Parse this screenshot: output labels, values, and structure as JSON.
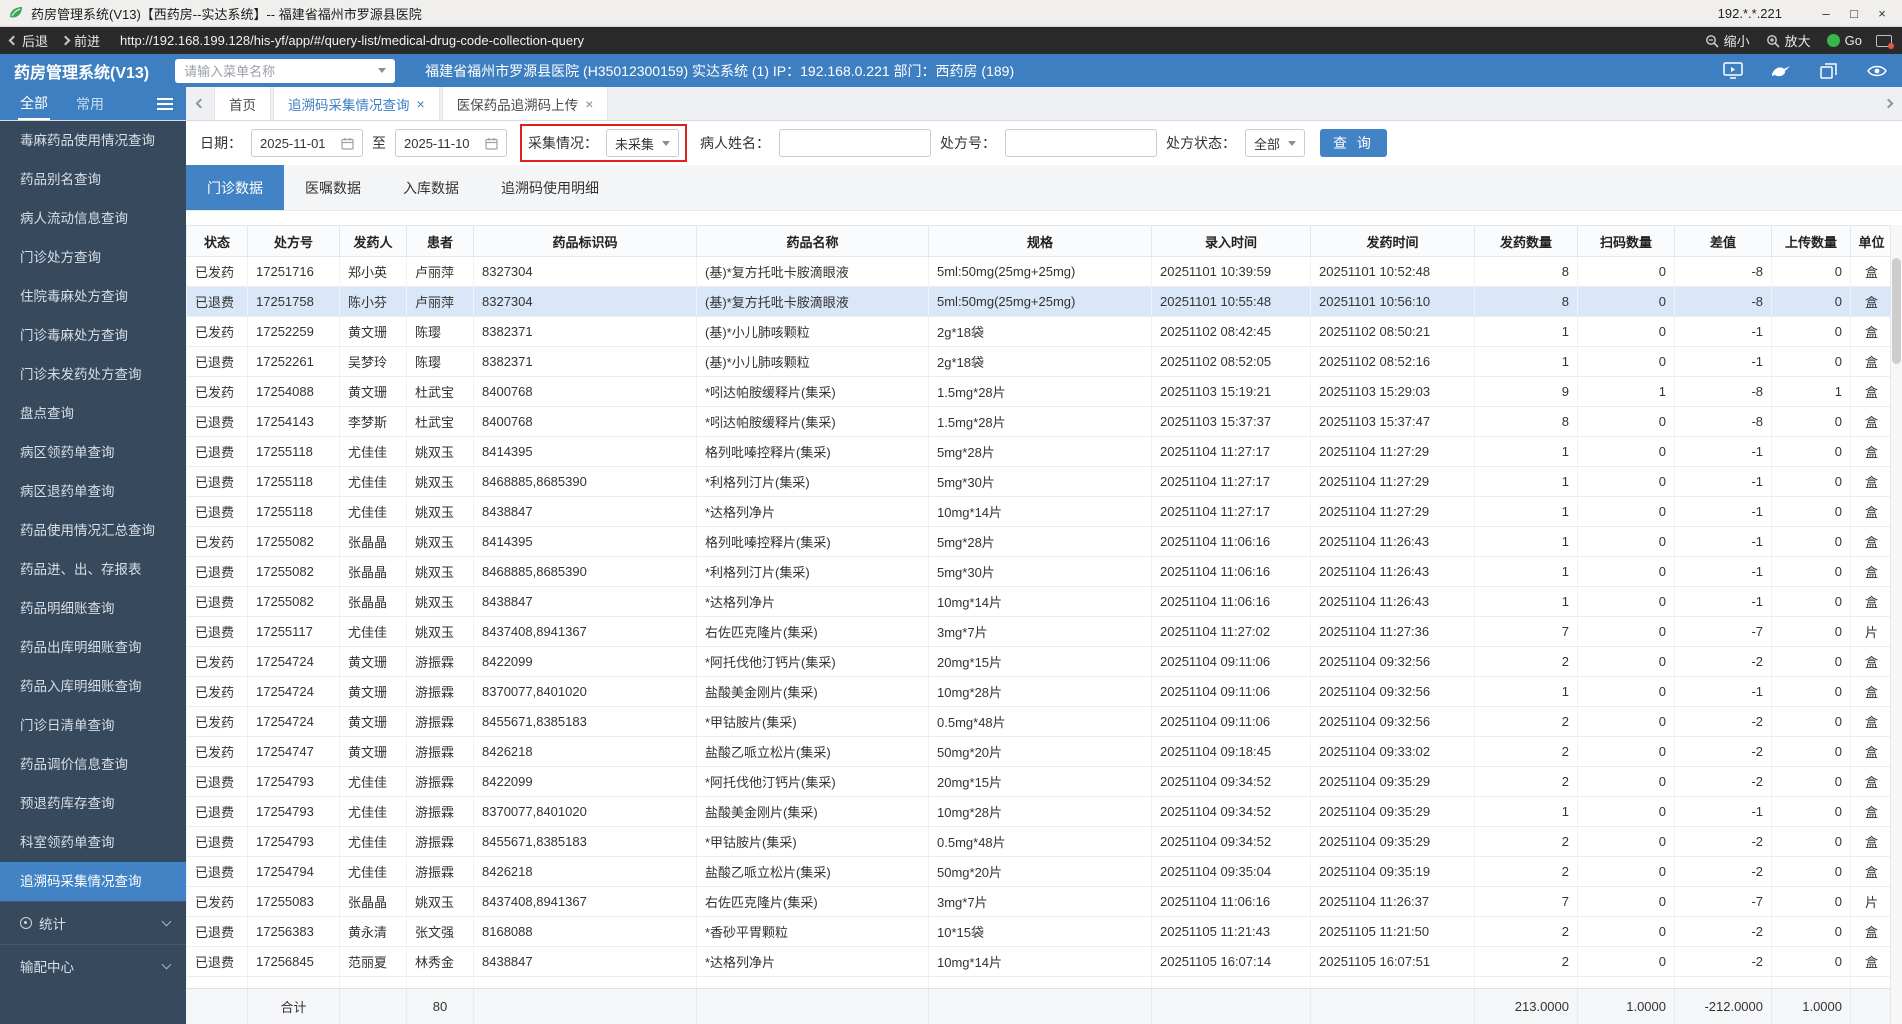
{
  "colors": {
    "accent_blue": "#4183c4",
    "header_blue": "#3e7fc1",
    "sidebar_bg": "#37495c",
    "highlight_row": "#d9e7f8",
    "alert_red": "#e0201c",
    "go_green": "#39b54a"
  },
  "titlebar": {
    "title": "药房管理系统(V13)【西药房--实达系统】-- 福建省福州市罗源县医院",
    "ip": "192.*.*.221",
    "window_controls": {
      "minimize": "–",
      "maximize": "□",
      "close": "×"
    }
  },
  "browser": {
    "back_label": "后退",
    "forward_label": "前进",
    "url": "http://192.168.199.128/his-yf/app/#/query-list/medical-drug-code-collection-query",
    "zoom_out_label": "缩小",
    "zoom_in_label": "放大",
    "go_label": "Go"
  },
  "header": {
    "app_name": "药房管理系统(V13)",
    "menu_search_placeholder": "请输入菜单名称",
    "hospital_info": "福建省福州市罗源县医院 (H35012300159) 实达系统 (1) IP：192.168.0.221 部门：西药房 (189)"
  },
  "tabstrip": {
    "all_label": "全部",
    "common_label": "常用",
    "tabs": [
      {
        "label": "首页",
        "closable": false,
        "active": false
      },
      {
        "label": "追溯码采集情况查询",
        "closable": true,
        "active": true
      },
      {
        "label": "医保药品追溯码上传",
        "closable": true,
        "active": false
      }
    ]
  },
  "sidebar": {
    "items": [
      "毒麻药品使用情况查询",
      "药品别名查询",
      "病人流动信息查询",
      "门诊处方查询",
      "住院毒麻处方查询",
      "门诊毒麻处方查询",
      "门诊未发药处方查询",
      "盘点查询",
      "病区领药单查询",
      "病区退药单查询",
      "药品使用情况汇总查询",
      "药品进、出、存报表",
      "药品明细账查询",
      "药品出库明细账查询",
      "药品入库明细账查询",
      "门诊日清单查询",
      "药品调价信息查询",
      "预退药库存查询",
      "科室领药单查询",
      "追溯码采集情况查询"
    ],
    "active_index": 19,
    "group_stats": "统计",
    "group_dispatch": "输配中心"
  },
  "filters": {
    "date_label": "日期：",
    "date_from": "2025-11-01",
    "to_label": "至",
    "date_to": "2025-11-10",
    "collect_label": "采集情况：",
    "collect_value": "未采集",
    "patient_label": "病人姓名：",
    "patient_value": "",
    "rx_label": "处方号：",
    "rx_value": "",
    "rx_status_label": "处方状态：",
    "rx_status_value": "全部",
    "query_button": "查 询"
  },
  "data_tabs": [
    "门诊数据",
    "医嘱数据",
    "入库数据",
    "追溯码使用明细"
  ],
  "data_tabs_active_index": 0,
  "table": {
    "columns": [
      "状态",
      "处方号",
      "发药人",
      "患者",
      "药品标识码",
      "药品名称",
      "规格",
      "录入时间",
      "发药时间",
      "发药数量",
      "扫码数量",
      "差值",
      "上传数量",
      "单位"
    ],
    "highlight_row_index": 1,
    "rows": [
      [
        "已发药",
        "17251716",
        "郑小英",
        "卢丽萍",
        "8327304",
        "(基)*复方托吡卡胺滴眼液",
        "5ml:50mg(25mg+25mg)",
        "20251101 10:39:59",
        "20251101 10:52:48",
        "8",
        "0",
        "-8",
        "0",
        "盒"
      ],
      [
        "已退费",
        "17251758",
        "陈小芬",
        "卢丽萍",
        "8327304",
        "(基)*复方托吡卡胺滴眼液",
        "5ml:50mg(25mg+25mg)",
        "20251101 10:55:48",
        "20251101 10:56:10",
        "8",
        "0",
        "-8",
        "0",
        "盒"
      ],
      [
        "已发药",
        "17252259",
        "黄文珊",
        "陈璎",
        "8382371",
        "(基)*小儿肺咳颗粒",
        "2g*18袋",
        "20251102 08:42:45",
        "20251102 08:50:21",
        "1",
        "0",
        "-1",
        "0",
        "盒"
      ],
      [
        "已退费",
        "17252261",
        "吴梦玲",
        "陈璎",
        "8382371",
        "(基)*小儿肺咳颗粒",
        "2g*18袋",
        "20251102 08:52:05",
        "20251102 08:52:16",
        "1",
        "0",
        "-1",
        "0",
        "盒"
      ],
      [
        "已发药",
        "17254088",
        "黄文珊",
        "杜武宝",
        "8400768",
        "*吲达帕胺缓释片(集采)",
        "1.5mg*28片",
        "20251103 15:19:21",
        "20251103 15:29:03",
        "9",
        "1",
        "-8",
        "1",
        "盒"
      ],
      [
        "已退费",
        "17254143",
        "李梦斯",
        "杜武宝",
        "8400768",
        "*吲达帕胺缓释片(集采)",
        "1.5mg*28片",
        "20251103 15:37:37",
        "20251103 15:37:47",
        "8",
        "0",
        "-8",
        "0",
        "盒"
      ],
      [
        "已退费",
        "17255118",
        "尤佳佳",
        "姚双玉",
        "8414395",
        "格列吡嗪控释片(集采)",
        "5mg*28片",
        "20251104 11:27:17",
        "20251104 11:27:29",
        "1",
        "0",
        "-1",
        "0",
        "盒"
      ],
      [
        "已退费",
        "17255118",
        "尤佳佳",
        "姚双玉",
        "8468885,8685390",
        "*利格列汀片(集采)",
        "5mg*30片",
        "20251104 11:27:17",
        "20251104 11:27:29",
        "1",
        "0",
        "-1",
        "0",
        "盒"
      ],
      [
        "已退费",
        "17255118",
        "尤佳佳",
        "姚双玉",
        "8438847",
        "*达格列净片",
        "10mg*14片",
        "20251104 11:27:17",
        "20251104 11:27:29",
        "1",
        "0",
        "-1",
        "0",
        "盒"
      ],
      [
        "已发药",
        "17255082",
        "张晶晶",
        "姚双玉",
        "8414395",
        "格列吡嗪控释片(集采)",
        "5mg*28片",
        "20251104 11:06:16",
        "20251104 11:26:43",
        "1",
        "0",
        "-1",
        "0",
        "盒"
      ],
      [
        "已退费",
        "17255082",
        "张晶晶",
        "姚双玉",
        "8468885,8685390",
        "*利格列汀片(集采)",
        "5mg*30片",
        "20251104 11:06:16",
        "20251104 11:26:43",
        "1",
        "0",
        "-1",
        "0",
        "盒"
      ],
      [
        "已退费",
        "17255082",
        "张晶晶",
        "姚双玉",
        "8438847",
        "*达格列净片",
        "10mg*14片",
        "20251104 11:06:16",
        "20251104 11:26:43",
        "1",
        "0",
        "-1",
        "0",
        "盒"
      ],
      [
        "已退费",
        "17255117",
        "尤佳佳",
        "姚双玉",
        "8437408,8941367",
        "右佐匹克隆片(集采)",
        "3mg*7片",
        "20251104 11:27:02",
        "20251104 11:27:36",
        "7",
        "0",
        "-7",
        "0",
        "片"
      ],
      [
        "已发药",
        "17254724",
        "黄文珊",
        "游振霖",
        "8422099",
        "*阿托伐他汀钙片(集采)",
        "20mg*15片",
        "20251104 09:11:06",
        "20251104 09:32:56",
        "2",
        "0",
        "-2",
        "0",
        "盒"
      ],
      [
        "已发药",
        "17254724",
        "黄文珊",
        "游振霖",
        "8370077,8401020",
        "盐酸美金刚片(集采)",
        "10mg*28片",
        "20251104 09:11:06",
        "20251104 09:32:56",
        "1",
        "0",
        "-1",
        "0",
        "盒"
      ],
      [
        "已发药",
        "17254724",
        "黄文珊",
        "游振霖",
        "8455671,8385183",
        "*甲钴胺片(集采)",
        "0.5mg*48片",
        "20251104 09:11:06",
        "20251104 09:32:56",
        "2",
        "0",
        "-2",
        "0",
        "盒"
      ],
      [
        "已发药",
        "17254747",
        "黄文珊",
        "游振霖",
        "8426218",
        "盐酸乙哌立松片(集采)",
        "50mg*20片",
        "20251104 09:18:45",
        "20251104 09:33:02",
        "2",
        "0",
        "-2",
        "0",
        "盒"
      ],
      [
        "已退费",
        "17254793",
        "尤佳佳",
        "游振霖",
        "8422099",
        "*阿托伐他汀钙片(集采)",
        "20mg*15片",
        "20251104 09:34:52",
        "20251104 09:35:29",
        "2",
        "0",
        "-2",
        "0",
        "盒"
      ],
      [
        "已退费",
        "17254793",
        "尤佳佳",
        "游振霖",
        "8370077,8401020",
        "盐酸美金刚片(集采)",
        "10mg*28片",
        "20251104 09:34:52",
        "20251104 09:35:29",
        "1",
        "0",
        "-1",
        "0",
        "盒"
      ],
      [
        "已退费",
        "17254793",
        "尤佳佳",
        "游振霖",
        "8455671,8385183",
        "*甲钴胺片(集采)",
        "0.5mg*48片",
        "20251104 09:34:52",
        "20251104 09:35:29",
        "2",
        "0",
        "-2",
        "0",
        "盒"
      ],
      [
        "已退费",
        "17254794",
        "尤佳佳",
        "游振霖",
        "8426218",
        "盐酸乙哌立松片(集采)",
        "50mg*20片",
        "20251104 09:35:04",
        "20251104 09:35:19",
        "2",
        "0",
        "-2",
        "0",
        "盒"
      ],
      [
        "已发药",
        "17255083",
        "张晶晶",
        "姚双玉",
        "8437408,8941367",
        "右佐匹克隆片(集采)",
        "3mg*7片",
        "20251104 11:06:16",
        "20251104 11:26:37",
        "7",
        "0",
        "-7",
        "0",
        "片"
      ],
      [
        "已退费",
        "17256383",
        "黄永清",
        "张文强",
        "8168088",
        "*香砂平胃颗粒",
        "10*15袋",
        "20251105 11:21:43",
        "20251105 11:21:50",
        "2",
        "0",
        "-2",
        "0",
        "盒"
      ],
      [
        "已退费",
        "17256845",
        "范丽夏",
        "林秀金",
        "8438847",
        "*达格列净片",
        "10mg*14片",
        "20251105 16:07:14",
        "20251105 16:07:51",
        "2",
        "0",
        "-2",
        "0",
        "盒"
      ],
      [
        "",
        "",
        "",
        "",
        "",
        "",
        "",
        "",
        "",
        "",
        "",
        "",
        "",
        ""
      ]
    ],
    "footer_cells": [
      "",
      "合计",
      "",
      "80",
      "",
      "",
      "",
      "",
      "",
      "213.0000",
      "1.0000",
      "-212.0000",
      "1.0000",
      ""
    ]
  }
}
